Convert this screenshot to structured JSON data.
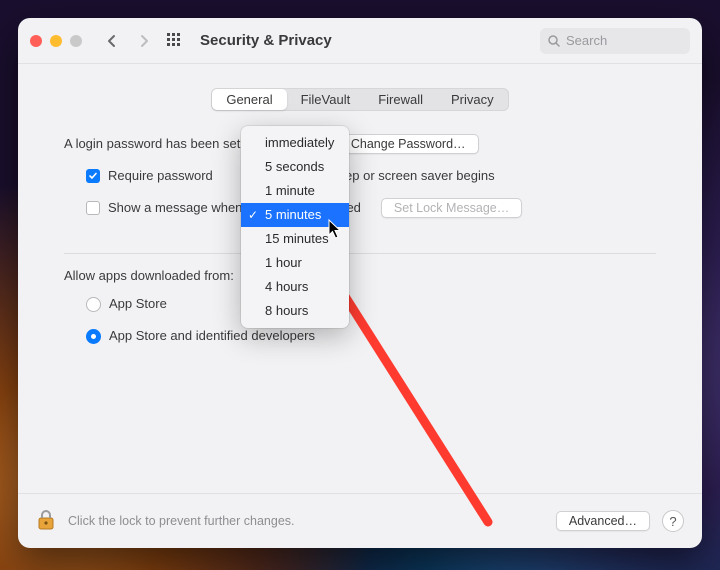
{
  "window_title": "Security & Privacy",
  "search_placeholder": "Search",
  "tabs": [
    "General",
    "FileVault",
    "Firewall",
    "Privacy"
  ],
  "active_tab": "General",
  "login_password_set_text": "A login password has been set for this user",
  "change_password_btn": "Change Password…",
  "require_password_checked": true,
  "require_password_label_a": "Require password",
  "require_password_label_b": "after sleep or screen saver begins",
  "show_msg_checked": false,
  "show_msg_label_a": "Show a message when the screen is locked",
  "set_lock_msg_btn": "Set Lock Message…",
  "dropdown": {
    "options": [
      "immediately",
      "5 seconds",
      "1 minute",
      "5 minutes",
      "15 minutes",
      "1 hour",
      "4 hours",
      "8 hours"
    ],
    "selected": "5 minutes"
  },
  "allow_apps_label": "Allow apps downloaded from:",
  "allow_apps_options": [
    "App Store",
    "App Store and identified developers"
  ],
  "allow_apps_selected": 1,
  "lock_hint": "Click the lock to prevent further changes.",
  "advanced_btn": "Advanced…",
  "help_btn": "?"
}
